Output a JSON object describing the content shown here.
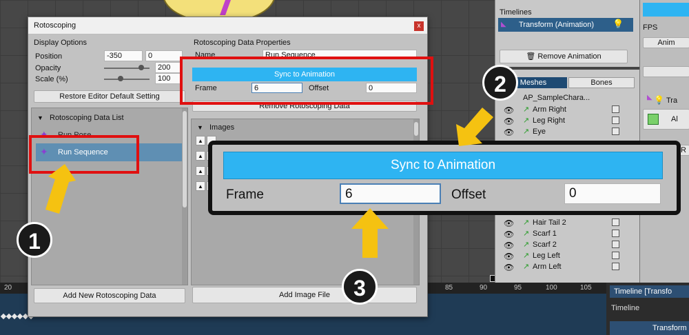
{
  "dialog": {
    "title": "Rotoscoping",
    "close_glyph": "x",
    "display_options": {
      "heading": "Display Options",
      "position_label": "Position",
      "position_x": "-350",
      "position_y": "0",
      "opacity_label": "Opacity",
      "opacity_value": "200",
      "scale_label": "Scale (%)",
      "scale_value": "100",
      "restore_button": "Restore Editor Default Setting"
    },
    "data_list": {
      "heading": "Rotoscoping Data List",
      "items": [
        {
          "label": "Run Pose",
          "selected": false
        },
        {
          "label": "Run Sequence",
          "selected": true
        }
      ],
      "add_button": "Add New Rotoscoping Data"
    },
    "properties": {
      "heading": "Rotoscoping Data Properties",
      "name_label": "Name",
      "name_value": "Run Sequence",
      "sync_button": "Sync to Animation",
      "frame_label": "Frame",
      "frame_value": "6",
      "offset_label": "Offset",
      "offset_value": "0",
      "remove_button": "Remove Rotoscoping Data",
      "images_heading": "Images",
      "add_image_button": "Add Image File"
    }
  },
  "zoom": {
    "sync_button": "Sync to Animation",
    "frame_label": "Frame",
    "frame_value": "6",
    "offset_label": "Offset",
    "offset_value": "0"
  },
  "right_panel": {
    "timelines_label": "Timelines",
    "timeline_item": "Transform (Animation)",
    "remove_animation_button": "Remove Animation",
    "tab_meshes": "Meshes",
    "tab_bones": "Bones",
    "root_name": "AP_SampleChara...",
    "layers_top": [
      "Arm Right",
      "Leg Right",
      "Eye"
    ],
    "layers_bottom": [
      "Hair Tail 2",
      "Scarf 1",
      "Scarf 2",
      "Leg Left",
      "Arm Left"
    ]
  },
  "far_right": {
    "fps_label": "FPS",
    "anim_label": "Anim",
    "tra_label": "Tra",
    "al_label": "Al",
    "r_label": "R"
  },
  "timeline": {
    "ruler_ticks": [
      "20",
      "85",
      "90",
      "95",
      "100",
      "105"
    ],
    "panel_title": "Timeline [Transfo",
    "label": "Timeline",
    "track_label": "Transform"
  },
  "callouts": {
    "badge_1": "1",
    "badge_2": "2",
    "badge_3": "3"
  },
  "colors": {
    "accent_blue": "#2eb4f2",
    "highlight_red": "#e01010",
    "arrow_yellow": "#f5c211",
    "selected_row": "#5f8fb3"
  }
}
